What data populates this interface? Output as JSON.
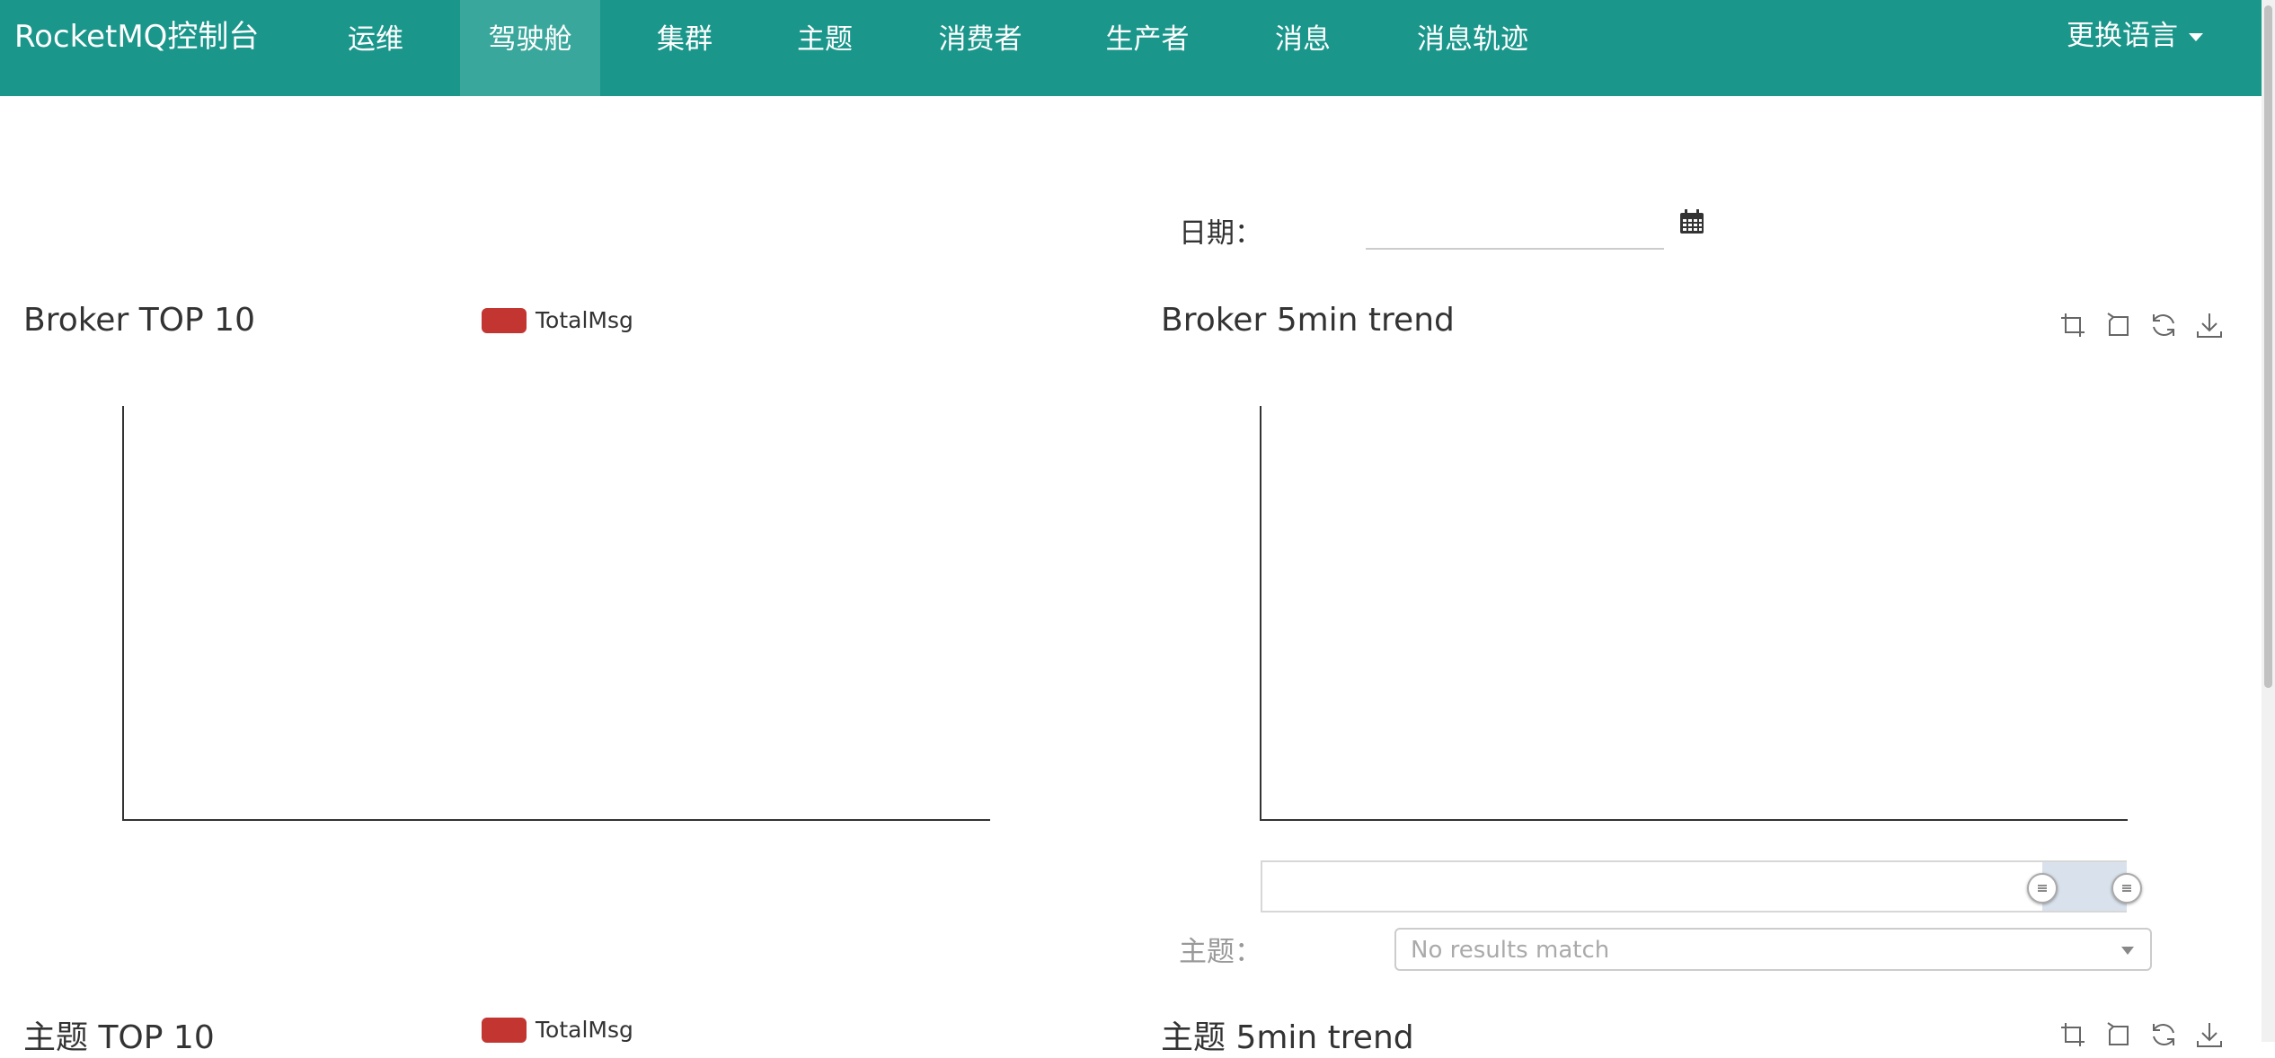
{
  "nav": {
    "brand": "RocketMQ控制台",
    "items": [
      {
        "label": "运维"
      },
      {
        "label": "驾驶舱"
      },
      {
        "label": "集群"
      },
      {
        "label": "主题"
      },
      {
        "label": "消费者"
      },
      {
        "label": "生产者"
      },
      {
        "label": "消息"
      },
      {
        "label": "消息轨迹"
      }
    ],
    "active_item": "驾驶舱",
    "language": "更换语言"
  },
  "date_filter": {
    "label": "日期：",
    "value": ""
  },
  "broker_top10": {
    "title": "Broker TOP 10",
    "legend": "TotalMsg",
    "legend_color": "#c23531"
  },
  "broker_trend": {
    "title": "Broker 5min trend"
  },
  "topic_filter": {
    "label": "主题：",
    "placeholder": "No results match"
  },
  "topic_top10": {
    "title": "主题 TOP 10",
    "legend": "TotalMsg",
    "legend_color": "#c23531"
  },
  "topic_trend": {
    "title": "主题 5min trend"
  },
  "toolbox_icons": [
    "zoom-icon",
    "zoom-reset-icon",
    "restore-icon",
    "save-image-icon"
  ],
  "colors": {
    "navbar": "#1a968b",
    "navbar_active": "#3aa79c"
  }
}
